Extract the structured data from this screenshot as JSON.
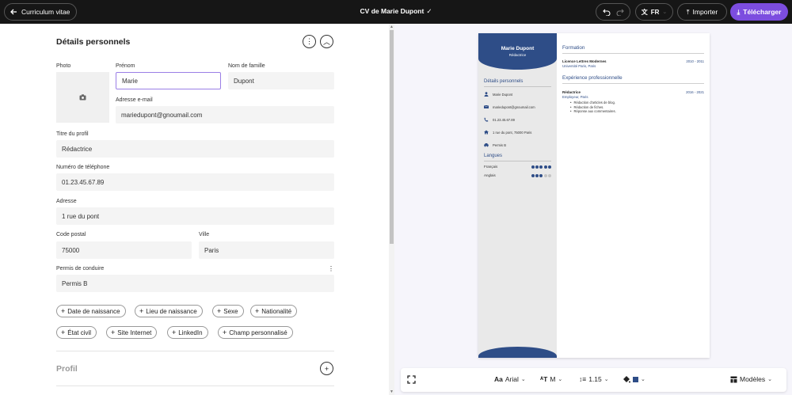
{
  "topbar": {
    "back_label": "Curriculum vitae",
    "doc_title": "CV de Marie Dupont",
    "saved_icon": "check-icon",
    "lang_code": "FR",
    "import_label": "Importer",
    "download_label": "Télécharger",
    "accent_color": "#7c4ddf"
  },
  "editor": {
    "section_title": "Détails personnels",
    "photo_label": "Photo",
    "first_name": {
      "label": "Prénom",
      "value": "Marie"
    },
    "last_name": {
      "label": "Nom de famille",
      "value": "Dupont"
    },
    "email": {
      "label": "Adresse e-mail",
      "value": "mariedupont@gnoumail.com"
    },
    "profile_title": {
      "label": "Titre du profil",
      "value": "Rédactrice"
    },
    "phone": {
      "label": "Numéro de téléphone",
      "value": "01.23.45.67.89"
    },
    "address": {
      "label": "Adresse",
      "value": "1 rue du pont"
    },
    "postal_code": {
      "label": "Code postal",
      "value": "75000"
    },
    "city": {
      "label": "Ville",
      "value": "Paris"
    },
    "license": {
      "label": "Permis de conduire",
      "value": "Permis B"
    },
    "chips": [
      "Date de naissance",
      "Lieu de naissance",
      "Sexe",
      "Nationalité",
      "État civil",
      "Site Internet",
      "LinkedIn",
      "Champ personnalisé"
    ],
    "next_section": "Profil"
  },
  "cv": {
    "name": "Marie Dupont",
    "job": "Rédactrice",
    "theme_color": "#2e4d87",
    "personal_title": "Détails personnels",
    "contacts": [
      {
        "icon": "user-icon",
        "text": "Marie Dupont"
      },
      {
        "icon": "mail-icon",
        "text": "mariedupont@gnoumail.com"
      },
      {
        "icon": "phone-icon",
        "text": "01.23.45.67.89"
      },
      {
        "icon": "home-icon",
        "text": "1 rue du pont, 75000 Paris"
      },
      {
        "icon": "car-icon",
        "text": "Permis B"
      }
    ],
    "languages_title": "Langues",
    "languages": [
      {
        "name": "Français",
        "level": 5,
        "max": 5
      },
      {
        "name": "Anglais",
        "level": 3,
        "max": 5
      }
    ],
    "education_title": "Formation",
    "education": [
      {
        "title": "Licence Lettres Modernes",
        "sub": "Université Paris, Paris",
        "dates": "2010 - 2011"
      }
    ],
    "experience_title": "Expérience professionnelle",
    "experience": [
      {
        "title": "Rédactrice",
        "sub": "Employeur, Paris",
        "dates": "2016 - 2021",
        "bullets": [
          "Rédaction d'articles de blog.",
          "Rédaction de fiches.",
          "Réponse aux commentaires."
        ]
      }
    ]
  },
  "toolbar": {
    "font": "Arial",
    "size": "M",
    "line_spacing": "1.15",
    "color": "#2e4d87",
    "templates_label": "Modèles"
  }
}
